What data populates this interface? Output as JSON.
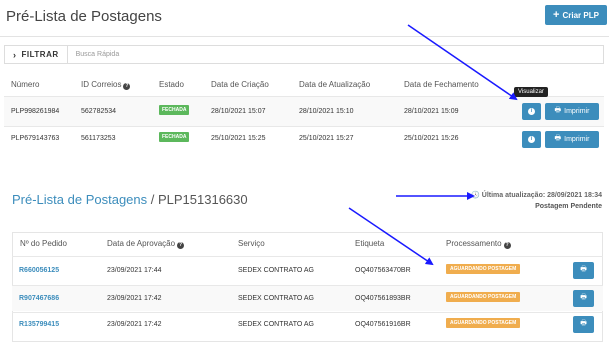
{
  "header": {
    "title": "Pré-Lista de Postagens",
    "create_button": "Criar PLP"
  },
  "filter": {
    "toggle_label": "FILTRAR",
    "quick_search_placeholder": "Busca Rápida"
  },
  "plp_table": {
    "columns": [
      "Número",
      "ID Correios",
      "Estado",
      "Data de Criação",
      "Data de Atualização",
      "Data de Fechamento"
    ],
    "rows": [
      {
        "numero": "PLP998261984",
        "id_correios": "562782534",
        "estado": "FECHADA",
        "criacao": "28/10/2021 15:07",
        "atualizacao": "28/10/2021 15:10",
        "fechamento": "28/10/2021 15:09"
      },
      {
        "numero": "PLP679143763",
        "id_correios": "561173253",
        "estado": "FECHADA",
        "criacao": "25/10/2021 15:25",
        "atualizacao": "25/10/2021 15:27",
        "fechamento": "25/10/2021 15:26"
      }
    ],
    "print_label": "Imprimir",
    "tooltip": "Visualizar"
  },
  "detail": {
    "breadcrumb_link": "Pré-Lista de Postagens",
    "separator": " / ",
    "plp_id": "PLP151316630",
    "last_update": "Última atualização: 28/09/2021 18:34",
    "status": "Postagem Pendente"
  },
  "orders_table": {
    "columns": [
      "Nº do Pedido",
      "Data de Aprovação",
      "Serviço",
      "Etiqueta",
      "Processamento"
    ],
    "rows": [
      {
        "pedido": "R660056125",
        "aprovacao": "23/09/2021 17:44",
        "servico": "SEDEX CONTRATO AG",
        "etiqueta": "OQ407563470BR",
        "processamento": "AGUARDANDO POSTAGEM"
      },
      {
        "pedido": "R907467686",
        "aprovacao": "23/09/2021 17:42",
        "servico": "SEDEX CONTRATO AG",
        "etiqueta": "OQ407561893BR",
        "processamento": "AGUARDANDO POSTAGEM"
      },
      {
        "pedido": "R135799415",
        "aprovacao": "23/09/2021 17:42",
        "servico": "SEDEX CONTRATO AG",
        "etiqueta": "OQ407561916BR",
        "processamento": "AGUARDANDO POSTAGEM"
      }
    ]
  },
  "colors": {
    "primary": "#3c8dbc",
    "success": "#5cb85c",
    "warning": "#f0ad4e",
    "annotation_arrow": "#1a1aff"
  },
  "icons": {
    "create": "plus-icon",
    "filter": "chevron-right-icon",
    "view": "info-icon",
    "print": "printer-icon",
    "help": "question-circle-icon",
    "clock": "clock-icon"
  }
}
